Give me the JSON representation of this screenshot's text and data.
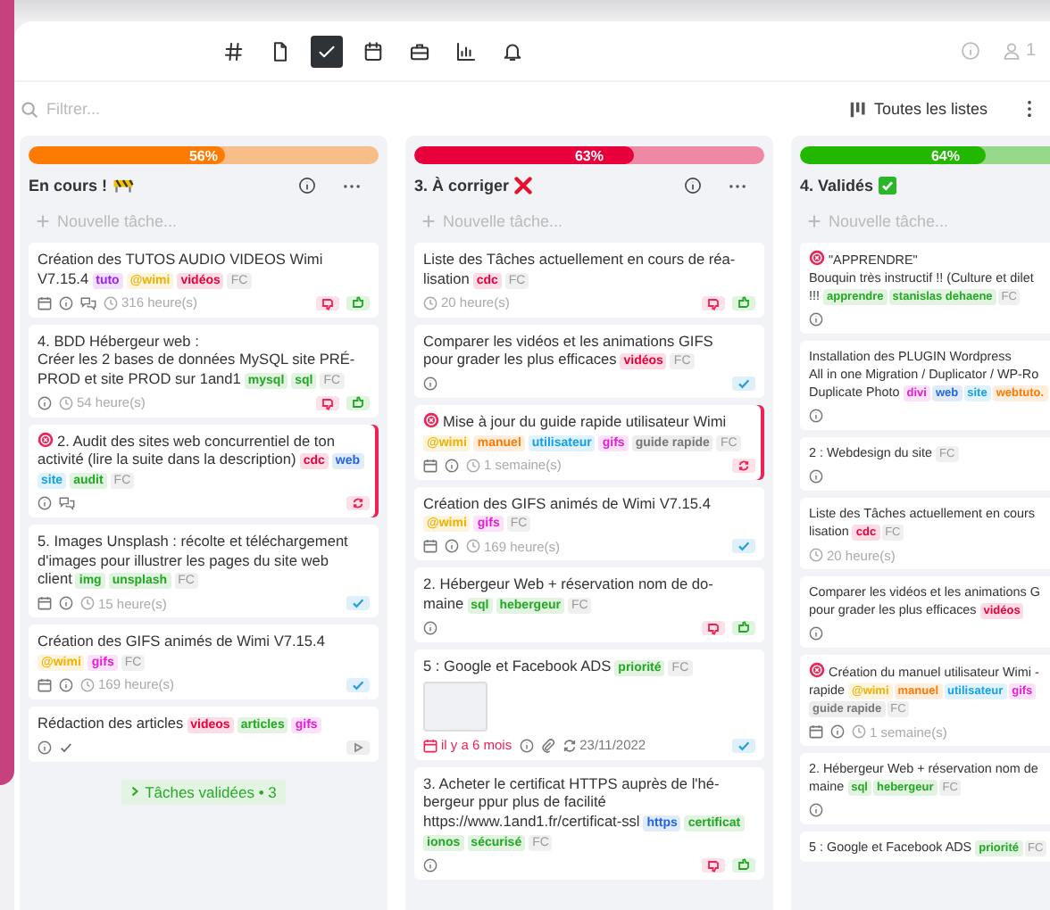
{
  "toolbar": {
    "icons": [
      {
        "kind": "hash",
        "selected": false
      },
      {
        "kind": "file",
        "selected": false
      },
      {
        "kind": "check",
        "selected": true
      },
      {
        "kind": "calendar",
        "selected": false
      },
      {
        "kind": "briefcase",
        "selected": false
      },
      {
        "kind": "chart",
        "selected": false
      },
      {
        "kind": "bell",
        "selected": false
      }
    ],
    "user_count": "1"
  },
  "filter": {
    "placeholder": "Filtrer...",
    "lists_button": "Toutes les listes"
  },
  "columns": [
    {
      "title": "En cours !",
      "title_icon": {
        "kind": "construction"
      },
      "progress": {
        "level": 0.56,
        "label": "56%",
        "color": "#ff7a00"
      },
      "new_task": "Nouvelle tâche...",
      "cards": [
        {
          "text": "Création des TUTOS AUDIO VIDEOS Wimi\nV7.15.4",
          "tags": [
            {
              "label": "tuto",
              "color": "#a020f0"
            },
            {
              "label": "@wimi",
              "color": "#f0b000"
            },
            {
              "label": "vidéos",
              "color": "#e8003d"
            }
          ],
          "fc": "FC",
          "footer": [
            {
              "kind": "calendar"
            },
            {
              "kind": "info"
            },
            {
              "kind": "comments"
            },
            {
              "kind": "clock",
              "text": "316 heure(s)"
            }
          ],
          "badges": [
            {
              "kind": "votes"
            }
          ]
        },
        {
          "text": "4. BDD Hébergeur web :\nCréer les 2 bases de données MySQL site PRÉ-\nPROD et site PROD sur 1and1",
          "tags": [
            {
              "label": "mysql",
              "color": "#22a822"
            },
            {
              "label": "sql",
              "color": "#22a822"
            }
          ],
          "fc": "FC",
          "footer": [
            {
              "kind": "info"
            },
            {
              "kind": "clock",
              "text": "54 heure(s)"
            }
          ],
          "badges": [
            {
              "kind": "votes"
            }
          ]
        },
        {
          "alert": true,
          "flagged": true,
          "text": "2. Audit des sites web concurrentiel de ton\nactivité (lire la suite dans la description)",
          "tags": [
            {
              "label": "cdc",
              "color": "#e8003d"
            },
            {
              "label": "web",
              "color": "#2266dd"
            },
            {
              "label": "site",
              "color": "#14a0e8"
            },
            {
              "label": "audit",
              "color": "#22a822"
            }
          ],
          "fc": "FC",
          "footer": [
            {
              "kind": "info"
            },
            {
              "kind": "comments"
            }
          ],
          "badges": [
            {
              "kind": "sync"
            }
          ]
        },
        {
          "text": "5. Images Unsplash : récolte et téléchargement\nd'images pour illustrer les pages du site web\nclient",
          "tags": [
            {
              "label": "img",
              "color": "#22a822"
            },
            {
              "label": "unsplash",
              "color": "#22a822"
            }
          ],
          "fc": "FC",
          "footer": [
            {
              "kind": "calendar"
            },
            {
              "kind": "info"
            },
            {
              "kind": "clock",
              "text": "15 heure(s)"
            }
          ],
          "badges": [
            {
              "kind": "done"
            }
          ]
        },
        {
          "text": "Création des GIFS animés de Wimi V7.15.4",
          "tags": [
            {
              "label": "@wimi",
              "color": "#f0b000"
            },
            {
              "label": "gifs",
              "color": "#e020d0"
            }
          ],
          "fc": "FC",
          "footer": [
            {
              "kind": "calendar"
            },
            {
              "kind": "info"
            },
            {
              "kind": "clock",
              "text": "169 heure(s)"
            }
          ],
          "badges": [
            {
              "kind": "done"
            }
          ]
        },
        {
          "text": "Rédaction des articles",
          "tags": [
            {
              "label": "videos",
              "color": "#e8003d"
            },
            {
              "label": "articles",
              "color": "#22a822"
            },
            {
              "label": "gifs",
              "color": "#e020d0"
            }
          ],
          "footer": [
            {
              "kind": "info"
            },
            {
              "kind": "check"
            }
          ],
          "badges": [
            {
              "kind": "play"
            }
          ]
        }
      ],
      "done_button": "Tâches validées • 3"
    },
    {
      "title": "3. À corriger",
      "title_icon": {
        "kind": "cross"
      },
      "progress": {
        "level": 0.63,
        "label": "63%",
        "color": "#e8003d"
      },
      "new_task": "Nouvelle tâche...",
      "cards": [
        {
          "text": "Liste des Tâches actuellement en cours de réa-\nlisation",
          "tags": [
            {
              "label": "cdc",
              "color": "#e8003d"
            }
          ],
          "fc": "FC",
          "footer": [
            {
              "kind": "clock",
              "text": "20 heure(s)"
            }
          ],
          "badges": [
            {
              "kind": "votes"
            }
          ]
        },
        {
          "text": "Comparer les vidéos et les animations GIFS\npour grader les plus efficaces",
          "tags": [
            {
              "label": "vidéos",
              "color": "#e8003d"
            }
          ],
          "fc": "FC",
          "footer": [
            {
              "kind": "info"
            }
          ],
          "badges": [
            {
              "kind": "done"
            }
          ]
        },
        {
          "alert": true,
          "flagged": true,
          "text": "Mise à jour du guide rapide utilisateur Wimi",
          "tags": [
            {
              "label": "@wimi",
              "color": "#f0b000"
            },
            {
              "label": "manuel",
              "color": "#ff7a00"
            },
            {
              "label": "utilisateur",
              "color": "#14a0e8"
            },
            {
              "label": "gifs",
              "color": "#e020d0"
            },
            {
              "label": "guide rapide",
              "color": "#777777"
            }
          ],
          "fc": "FC",
          "footer": [
            {
              "kind": "calendar"
            },
            {
              "kind": "info"
            },
            {
              "kind": "clock",
              "text": "1 semaine(s)"
            }
          ],
          "badges": [
            {
              "kind": "sync"
            }
          ]
        },
        {
          "text": "Création des GIFS animés de Wimi V7.15.4",
          "tags": [
            {
              "label": "@wimi",
              "color": "#f0b000"
            },
            {
              "label": "gifs",
              "color": "#e020d0"
            }
          ],
          "fc": "FC",
          "footer": [
            {
              "kind": "calendar"
            },
            {
              "kind": "info"
            },
            {
              "kind": "clock",
              "text": "169 heure(s)"
            }
          ],
          "badges": [
            {
              "kind": "done"
            }
          ]
        },
        {
          "text": "2. Hébergeur Web + réservation nom de do-\nmaine",
          "tags": [
            {
              "label": "sql",
              "color": "#22a822"
            },
            {
              "label": "hebergeur",
              "color": "#22a822"
            }
          ],
          "fc": "FC",
          "footer": [
            {
              "kind": "info"
            }
          ],
          "badges": [
            {
              "kind": "votes"
            }
          ]
        },
        {
          "text": "5 : Google et Facebook ADS",
          "tags": [
            {
              "label": "priorité",
              "color": "#22a822"
            }
          ],
          "fc": "FC",
          "thumbnail": true,
          "footer": [
            {
              "kind": "due",
              "text": "il y a 6 mois"
            },
            {
              "kind": "info"
            },
            {
              "kind": "attach"
            },
            {
              "kind": "sync",
              "text": "23/11/2022"
            }
          ],
          "badges": [
            {
              "kind": "done"
            }
          ]
        },
        {
          "text": "3. Acheter le certificat HTTPS auprès de l'hé-\nbergeur ppur plus de facilité\nhttps://www.1and1.fr/certificat-ssl",
          "tags": [
            {
              "label": "https",
              "color": "#2266dd"
            },
            {
              "label": "certificat",
              "color": "#22a822"
            },
            {
              "label": "ionos",
              "color": "#22a822"
            },
            {
              "label": "sécurisé",
              "color": "#22a822"
            }
          ],
          "fc": "FC",
          "footer": [
            {
              "kind": "info"
            }
          ],
          "badges": [
            {
              "kind": "votes"
            }
          ]
        }
      ]
    },
    {
      "title": "4. Validés",
      "title_icon": {
        "kind": "check"
      },
      "progress": {
        "level": 0.64,
        "label": "64%",
        "color": "#22b800"
      },
      "new_task": "Nouvelle tâche...",
      "cards": [
        {
          "alert": true,
          "text": "\"APPRENDRE\"\nBouquin très instructif !! (Culture et dilet\n!!!",
          "tags": [
            {
              "label": "apprendre",
              "color": "#22a822"
            },
            {
              "label": "stanislas dehaene",
              "color": "#22a822"
            }
          ],
          "fc": "FC",
          "footer": [
            {
              "kind": "info"
            }
          ]
        },
        {
          "text": "Installation des PLUGIN Wordpress\nAll in one Migration / Duplicator / WP-Ro\nDuplicate Photo",
          "tags": [
            {
              "label": "divi",
              "color": "#e020d0"
            },
            {
              "label": "web",
              "color": "#2266dd"
            },
            {
              "label": "site",
              "color": "#14a0e8"
            },
            {
              "label": "webtuto.",
              "color": "#ff7a00"
            }
          ],
          "footer": [
            {
              "kind": "info"
            }
          ]
        },
        {
          "text": "2 : Webdesign du site",
          "fc": "FC",
          "footer": [
            {
              "kind": "info"
            }
          ]
        },
        {
          "text": "Liste des Tâches actuellement en cours\nlisation",
          "tags": [
            {
              "label": "cdc",
              "color": "#e8003d"
            }
          ],
          "fc": "FC",
          "footer": [
            {
              "kind": "clock",
              "text": "20 heure(s)"
            }
          ]
        },
        {
          "text": "Comparer les vidéos et les animations G\npour grader les plus efficaces",
          "tags": [
            {
              "label": "vidéos",
              "color": "#e8003d"
            }
          ],
          "footer": [
            {
              "kind": "info"
            }
          ]
        },
        {
          "alert": true,
          "text": "Création du manuel utilisateur Wimi -\nrapide",
          "tags": [
            {
              "label": "@wimi",
              "color": "#f0b000"
            },
            {
              "label": "manuel",
              "color": "#ff7a00"
            },
            {
              "label": "utilisateur",
              "color": "#14a0e8"
            },
            {
              "label": "gifs",
              "color": "#e020d0"
            },
            {
              "label": "guide rapide",
              "color": "#777777"
            }
          ],
          "fc": "FC",
          "footer": [
            {
              "kind": "calendar"
            },
            {
              "kind": "info"
            },
            {
              "kind": "clock",
              "text": "1 semaine(s)"
            }
          ]
        },
        {
          "text": "2. Hébergeur Web + réservation nom de\nmaine",
          "tags": [
            {
              "label": "sql",
              "color": "#22a822"
            },
            {
              "label": "hebergeur",
              "color": "#22a822"
            }
          ],
          "fc": "FC",
          "footer": [
            {
              "kind": "info"
            }
          ]
        },
        {
          "text": "5 : Google et Facebook ADS",
          "tags": [
            {
              "label": "priorité",
              "color": "#22a822"
            }
          ],
          "fc": "FC"
        }
      ]
    }
  ]
}
